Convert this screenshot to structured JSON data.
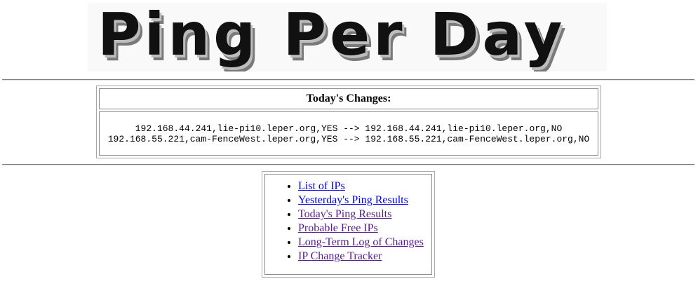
{
  "banner": {
    "title": "Ping Per Day"
  },
  "changes": {
    "heading": "Today's Changes:",
    "lines": [
      "192.168.44.241,lie-pi10.leper.org,YES --> 192.168.44.241,lie-pi10.leper.org,NO",
      "192.168.55.221,cam-FenceWest.leper.org,YES --> 192.168.55.221,cam-FenceWest.leper.org,NO"
    ]
  },
  "nav": {
    "links": [
      {
        "label": "List of IPs",
        "state": "unvisited"
      },
      {
        "label": "Yesterday's Ping Results",
        "state": "unvisited"
      },
      {
        "label": "Today's Ping Results",
        "state": "visited"
      },
      {
        "label": "Probable Free IPs",
        "state": "visited"
      },
      {
        "label": "Long-Term Log of Changes",
        "state": "visited"
      },
      {
        "label": "IP Change Tracker",
        "state": "visited"
      }
    ]
  },
  "colors": {
    "link_unvisited": "#0000ee",
    "link_visited": "#551a8b",
    "banner_text": "#111111",
    "banner_shadow": "#7a7a7a"
  }
}
